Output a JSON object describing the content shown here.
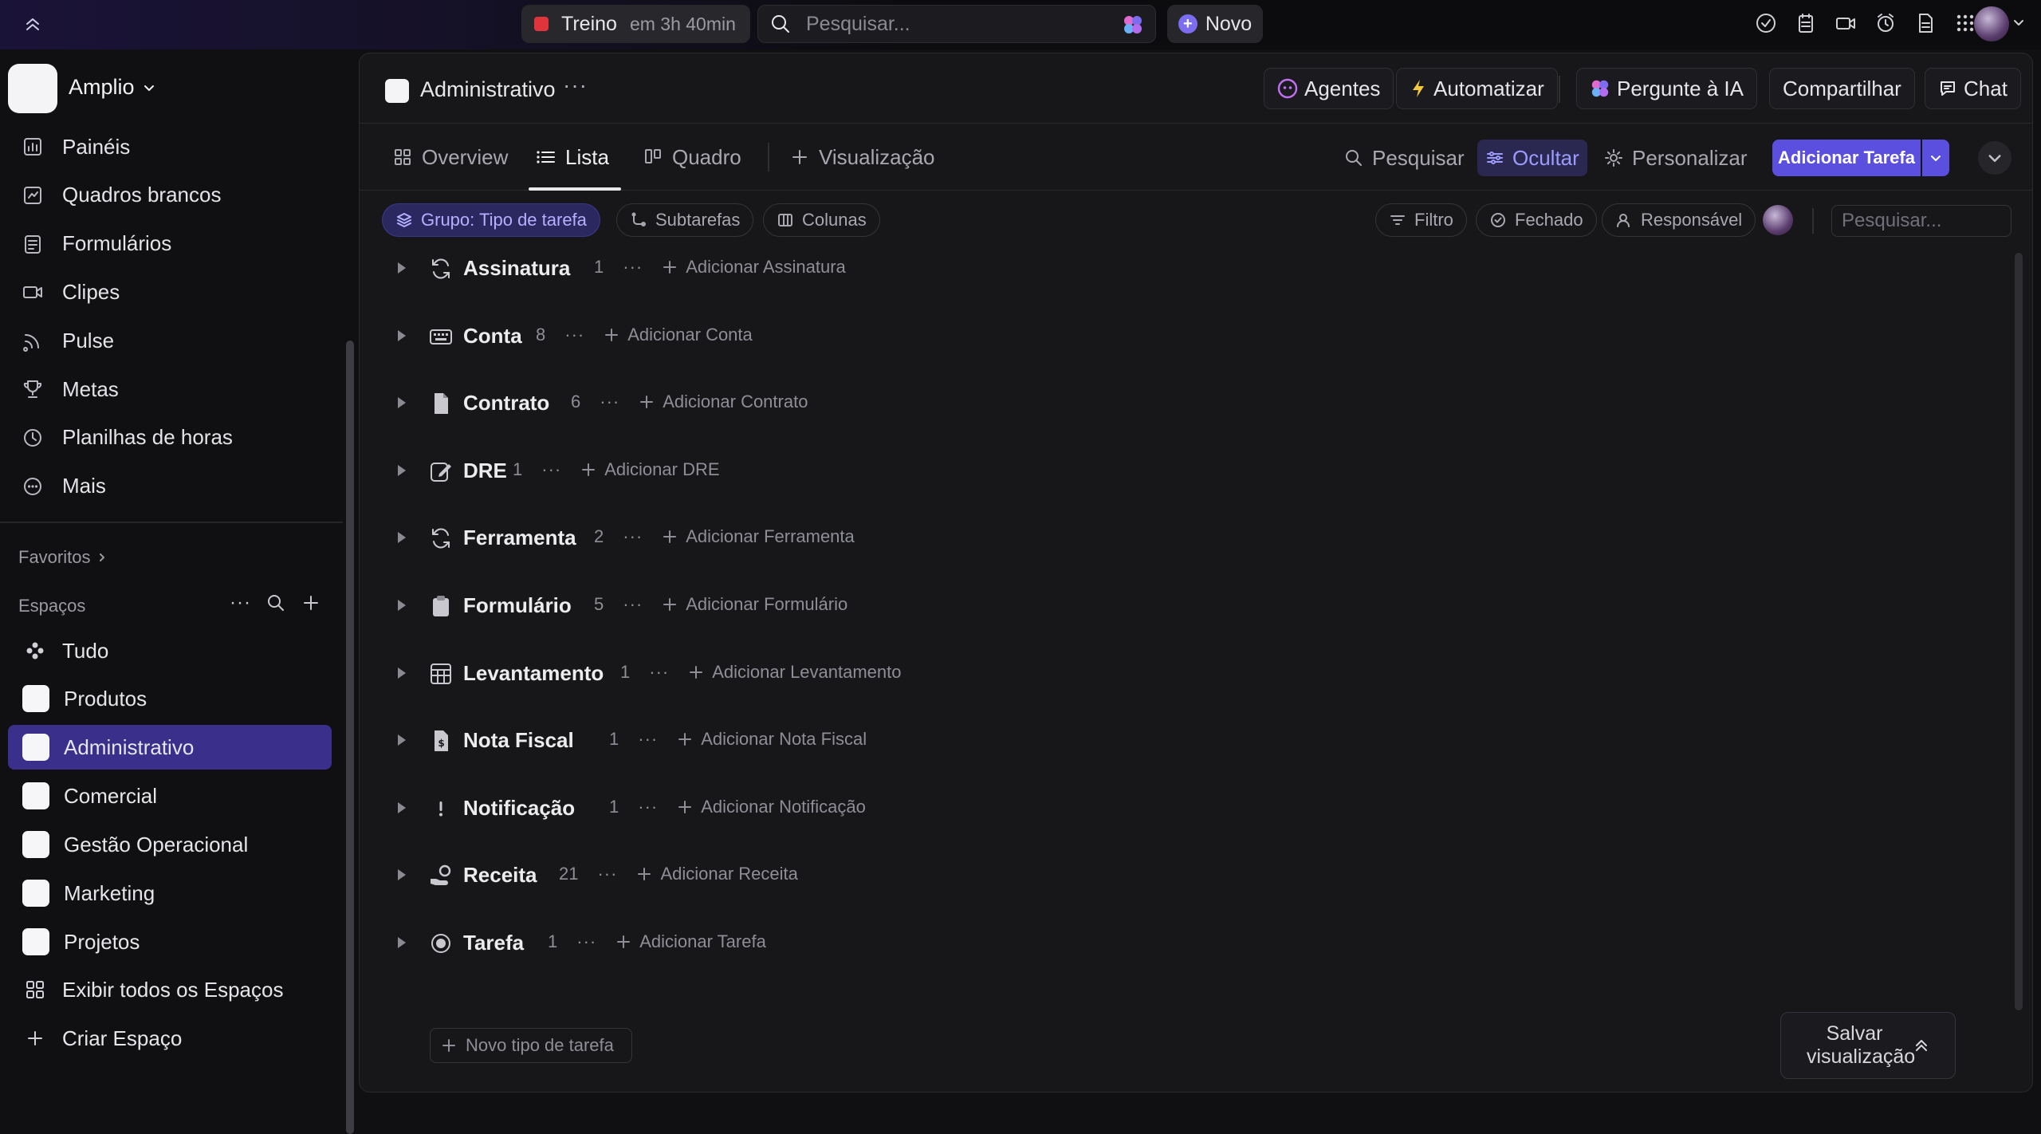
{
  "topbar": {
    "timer_title": "Treino",
    "timer_subtitle": "em 3h 40min",
    "search_placeholder": "Pesquisar...",
    "new_label": "Novo"
  },
  "sidebar": {
    "workspace_name": "Amplio",
    "nav": [
      {
        "label": "Painéis",
        "icon": "dashboard-icon"
      },
      {
        "label": "Quadros brancos",
        "icon": "whiteboard-icon"
      },
      {
        "label": "Formulários",
        "icon": "form-icon"
      },
      {
        "label": "Clipes",
        "icon": "video-icon"
      },
      {
        "label": "Pulse",
        "icon": "pulse-icon"
      },
      {
        "label": "Metas",
        "icon": "trophy-icon"
      },
      {
        "label": "Planilhas de horas",
        "icon": "clock-icon"
      },
      {
        "label": "Mais",
        "icon": "more-circle-icon"
      }
    ],
    "favorites_label": "Favoritos",
    "spaces_label": "Espaços",
    "spaces": [
      {
        "label": "Tudo",
        "type": "all"
      },
      {
        "label": "Produtos",
        "type": "space"
      },
      {
        "label": "Administrativo",
        "type": "space",
        "active": true
      },
      {
        "label": "Comercial",
        "type": "space"
      },
      {
        "label": "Gestão Operacional",
        "type": "space"
      },
      {
        "label": "Marketing",
        "type": "space"
      },
      {
        "label": "Projetos",
        "type": "space"
      },
      {
        "label": "Exibir todos os Espaços",
        "type": "grid"
      },
      {
        "label": "Criar Espaço",
        "type": "plus"
      }
    ]
  },
  "main": {
    "title": "Administrativo",
    "header_buttons": {
      "agents": "Agentes",
      "automate": "Automatizar",
      "ask_ai": "Pergunte à IA",
      "share": "Compartilhar",
      "chat": "Chat"
    },
    "tabs": [
      {
        "label": "Overview"
      },
      {
        "label": "Lista",
        "active": true
      },
      {
        "label": "Quadro"
      },
      {
        "label": "Visualização"
      }
    ],
    "tools": {
      "search": "Pesquisar",
      "hide": "Ocultar",
      "customize": "Personalizar",
      "add_task": "Adicionar Tarefa"
    },
    "chips": {
      "group": "Grupo: Tipo de tarefa",
      "subtasks": "Subtarefas",
      "columns": "Colunas",
      "filter": "Filtro",
      "closed": "Fechado",
      "assignee": "Responsável"
    },
    "filter_search_placeholder": "Pesquisar...",
    "groups": [
      {
        "title": "Assinatura",
        "count": "1",
        "add": "Adicionar Assinatura",
        "icon": "refresh-icon"
      },
      {
        "title": "Conta",
        "count": "8",
        "add": "Adicionar Conta",
        "icon": "keyboard-icon"
      },
      {
        "title": "Contrato",
        "count": "6",
        "add": "Adicionar Contrato",
        "icon": "document-icon"
      },
      {
        "title": "DRE",
        "count": "1",
        "add": "Adicionar DRE",
        "icon": "edit-icon"
      },
      {
        "title": "Ferramenta",
        "count": "2",
        "add": "Adicionar Ferramenta",
        "icon": "refresh-icon"
      },
      {
        "title": "Formulário",
        "count": "5",
        "add": "Adicionar Formulário",
        "icon": "clipboard-icon"
      },
      {
        "title": "Levantamento",
        "count": "1",
        "add": "Adicionar Levantamento",
        "icon": "spreadsheet-icon"
      },
      {
        "title": "Nota Fiscal",
        "count": "1",
        "add": "Adicionar Nota Fiscal",
        "icon": "invoice-icon"
      },
      {
        "title": "Notificação",
        "count": "1",
        "add": "Adicionar Notificação",
        "icon": "exclamation-icon"
      },
      {
        "title": "Receita",
        "count": "21",
        "add": "Adicionar Receita",
        "icon": "money-hand-icon"
      },
      {
        "title": "Tarefa",
        "count": "1",
        "add": "Adicionar Tarefa",
        "icon": "radio-icon"
      }
    ],
    "new_type_label": "Novo tipo de tarefa",
    "save_view_label": "Salvar visualização"
  }
}
